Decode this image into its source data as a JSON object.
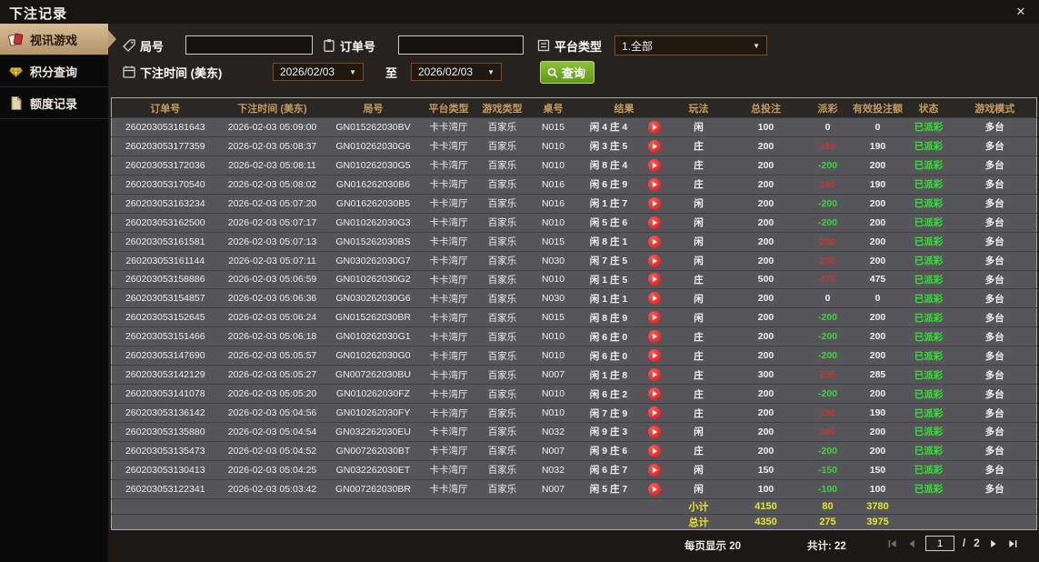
{
  "window": {
    "title": "下注记录",
    "close_glyph": "✕"
  },
  "sidebar": {
    "items": [
      {
        "label": "视讯游戏",
        "icon": "cards-icon",
        "active": true
      },
      {
        "label": "积分查询",
        "icon": "gem-icon",
        "active": false
      },
      {
        "label": "额度记录",
        "icon": "document-icon",
        "active": false
      }
    ]
  },
  "filters": {
    "round_label": "局号",
    "round_value": "",
    "order_label": "订单号",
    "order_value": "",
    "platform_label": "平台类型",
    "platform_value": "1.全部",
    "bet_time_label": "下注时间 (美东)",
    "date_from": "2026/02/03",
    "to_label": "至",
    "date_to": "2026/02/03",
    "search_label": "查询"
  },
  "table": {
    "headers": [
      "订单号",
      "下注时间 (美东)",
      "局号",
      "平台类型",
      "游戏类型",
      "桌号",
      "结果",
      "玩法",
      "总投注",
      "派彩",
      "有效投注额",
      "状态",
      "游戏模式"
    ],
    "rows": [
      {
        "order": "260203053181643",
        "time": "2026-02-03 05:09:00",
        "round": "GN015262030BV",
        "platform": "卡卡湾厅",
        "game": "百家乐",
        "table_no": "N015",
        "result": "闲 4 庄 4",
        "play_type": "闲",
        "bet": "100",
        "payout": "0",
        "valid": "0",
        "status": "已派彩",
        "mode": "多台"
      },
      {
        "order": "260203053177359",
        "time": "2026-02-03 05:08:37",
        "round": "GN010262030G6",
        "platform": "卡卡湾厅",
        "game": "百家乐",
        "table_no": "N010",
        "result": "闲 3 庄 5",
        "play_type": "庄",
        "bet": "200",
        "payout": "190",
        "valid": "190",
        "status": "已派彩",
        "mode": "多台"
      },
      {
        "order": "260203053172036",
        "time": "2026-02-03 05:08:11",
        "round": "GN010262030G5",
        "platform": "卡卡湾厅",
        "game": "百家乐",
        "table_no": "N010",
        "result": "闲 8 庄 4",
        "play_type": "庄",
        "bet": "200",
        "payout": "-200",
        "valid": "200",
        "status": "已派彩",
        "mode": "多台"
      },
      {
        "order": "260203053170540",
        "time": "2026-02-03 05:08:02",
        "round": "GN016262030B6",
        "platform": "卡卡湾厅",
        "game": "百家乐",
        "table_no": "N016",
        "result": "闲 6 庄 9",
        "play_type": "庄",
        "bet": "200",
        "payout": "190",
        "valid": "190",
        "status": "已派彩",
        "mode": "多台"
      },
      {
        "order": "260203053163234",
        "time": "2026-02-03 05:07:20",
        "round": "GN016262030B5",
        "platform": "卡卡湾厅",
        "game": "百家乐",
        "table_no": "N016",
        "result": "闲 1 庄 7",
        "play_type": "闲",
        "bet": "200",
        "payout": "-200",
        "valid": "200",
        "status": "已派彩",
        "mode": "多台"
      },
      {
        "order": "260203053162500",
        "time": "2026-02-03 05:07:17",
        "round": "GN010262030G3",
        "platform": "卡卡湾厅",
        "game": "百家乐",
        "table_no": "N010",
        "result": "闲 5 庄 6",
        "play_type": "闲",
        "bet": "200",
        "payout": "-200",
        "valid": "200",
        "status": "已派彩",
        "mode": "多台"
      },
      {
        "order": "260203053161581",
        "time": "2026-02-03 05:07:13",
        "round": "GN015262030BS",
        "platform": "卡卡湾厅",
        "game": "百家乐",
        "table_no": "N015",
        "result": "闲 8 庄 1",
        "play_type": "闲",
        "bet": "200",
        "payout": "200",
        "valid": "200",
        "status": "已派彩",
        "mode": "多台"
      },
      {
        "order": "260203053161144",
        "time": "2026-02-03 05:07:11",
        "round": "GN030262030G7",
        "platform": "卡卡湾厅",
        "game": "百家乐",
        "table_no": "N030",
        "result": "闲 7 庄 5",
        "play_type": "闲",
        "bet": "200",
        "payout": "200",
        "valid": "200",
        "status": "已派彩",
        "mode": "多台"
      },
      {
        "order": "260203053158886",
        "time": "2026-02-03 05:06:59",
        "round": "GN010262030G2",
        "platform": "卡卡湾厅",
        "game": "百家乐",
        "table_no": "N010",
        "result": "闲 1 庄 5",
        "play_type": "庄",
        "bet": "500",
        "payout": "475",
        "valid": "475",
        "status": "已派彩",
        "mode": "多台"
      },
      {
        "order": "260203053154857",
        "time": "2026-02-03 05:06:36",
        "round": "GN030262030G6",
        "platform": "卡卡湾厅",
        "game": "百家乐",
        "table_no": "N030",
        "result": "闲 1 庄 1",
        "play_type": "闲",
        "bet": "200",
        "payout": "0",
        "valid": "0",
        "status": "已派彩",
        "mode": "多台"
      },
      {
        "order": "260203053152645",
        "time": "2026-02-03 05:06:24",
        "round": "GN015262030BR",
        "platform": "卡卡湾厅",
        "game": "百家乐",
        "table_no": "N015",
        "result": "闲 8 庄 9",
        "play_type": "闲",
        "bet": "200",
        "payout": "-200",
        "valid": "200",
        "status": "已派彩",
        "mode": "多台"
      },
      {
        "order": "260203053151466",
        "time": "2026-02-03 05:06:18",
        "round": "GN010262030G1",
        "platform": "卡卡湾厅",
        "game": "百家乐",
        "table_no": "N010",
        "result": "闲 6 庄 0",
        "play_type": "庄",
        "bet": "200",
        "payout": "-200",
        "valid": "200",
        "status": "已派彩",
        "mode": "多台"
      },
      {
        "order": "260203053147690",
        "time": "2026-02-03 05:05:57",
        "round": "GN010262030G0",
        "platform": "卡卡湾厅",
        "game": "百家乐",
        "table_no": "N010",
        "result": "闲 6 庄 0",
        "play_type": "庄",
        "bet": "200",
        "payout": "-200",
        "valid": "200",
        "status": "已派彩",
        "mode": "多台"
      },
      {
        "order": "260203053142129",
        "time": "2026-02-03 05:05:27",
        "round": "GN007262030BU",
        "platform": "卡卡湾厅",
        "game": "百家乐",
        "table_no": "N007",
        "result": "闲 1 庄 8",
        "play_type": "庄",
        "bet": "300",
        "payout": "285",
        "valid": "285",
        "status": "已派彩",
        "mode": "多台"
      },
      {
        "order": "260203053141078",
        "time": "2026-02-03 05:05:20",
        "round": "GN010262030FZ",
        "platform": "卡卡湾厅",
        "game": "百家乐",
        "table_no": "N010",
        "result": "闲 6 庄 2",
        "play_type": "庄",
        "bet": "200",
        "payout": "-200",
        "valid": "200",
        "status": "已派彩",
        "mode": "多台"
      },
      {
        "order": "260203053136142",
        "time": "2026-02-03 05:04:56",
        "round": "GN010262030FY",
        "platform": "卡卡湾厅",
        "game": "百家乐",
        "table_no": "N010",
        "result": "闲 7 庄 9",
        "play_type": "庄",
        "bet": "200",
        "payout": "190",
        "valid": "190",
        "status": "已派彩",
        "mode": "多台"
      },
      {
        "order": "260203053135880",
        "time": "2026-02-03 05:04:54",
        "round": "GN032262030EU",
        "platform": "卡卡湾厅",
        "game": "百家乐",
        "table_no": "N032",
        "result": "闲 9 庄 3",
        "play_type": "闲",
        "bet": "200",
        "payout": "200",
        "valid": "200",
        "status": "已派彩",
        "mode": "多台"
      },
      {
        "order": "260203053135473",
        "time": "2026-02-03 05:04:52",
        "round": "GN007262030BT",
        "platform": "卡卡湾厅",
        "game": "百家乐",
        "table_no": "N007",
        "result": "闲 9 庄 6",
        "play_type": "庄",
        "bet": "200",
        "payout": "-200",
        "valid": "200",
        "status": "已派彩",
        "mode": "多台"
      },
      {
        "order": "260203053130413",
        "time": "2026-02-03 05:04:25",
        "round": "GN032262030ET",
        "platform": "卡卡湾厅",
        "game": "百家乐",
        "table_no": "N032",
        "result": "闲 6 庄 7",
        "play_type": "闲",
        "bet": "150",
        "payout": "-150",
        "valid": "150",
        "status": "已派彩",
        "mode": "多台"
      },
      {
        "order": "260203053122341",
        "time": "2026-02-03 05:03:42",
        "round": "GN007262030BR",
        "platform": "卡卡湾厅",
        "game": "百家乐",
        "table_no": "N007",
        "result": "闲 5 庄 7",
        "play_type": "闲",
        "bet": "100",
        "payout": "-100",
        "valid": "100",
        "status": "已派彩",
        "mode": "多台"
      }
    ],
    "subtotal": {
      "label": "小计",
      "bet": "4150",
      "payout": "80",
      "valid": "3780"
    },
    "total": {
      "label": "总计",
      "bet": "4350",
      "payout": "275",
      "valid": "3975"
    }
  },
  "footer": {
    "page_size_label": "每页显示 20",
    "total_label": "共计: 22",
    "page_value": "1",
    "page_sep": "/",
    "page_count": "2"
  },
  "colors": {
    "accent_tan": "#c9ae85",
    "header_gold": "#c79b5c",
    "button_green": "#6aa81e",
    "win_red": "#c03a3a",
    "loss_green": "#3fd23f",
    "status_green": "#31e431",
    "summary_yellow": "#e6e62e"
  }
}
